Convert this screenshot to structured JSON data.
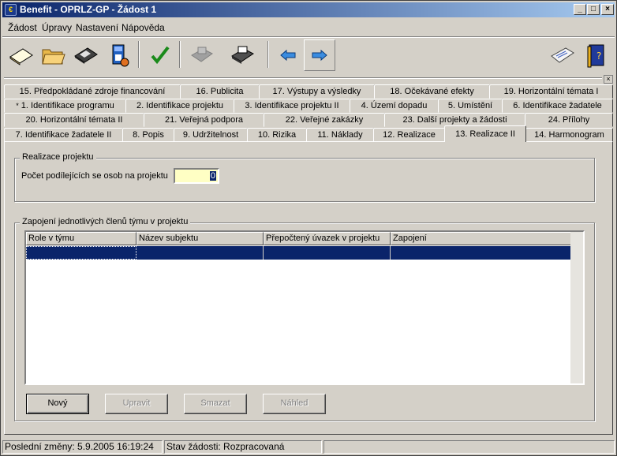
{
  "window": {
    "title": "Benefit - OPRLZ-GP - Žádost 1",
    "buttons": {
      "minimize": "_",
      "maximize": "□",
      "close": "×"
    }
  },
  "menu": [
    {
      "name": "zadost",
      "label": "Žádost"
    },
    {
      "name": "upravy",
      "label": "Úpravy"
    },
    {
      "name": "nastaveni",
      "label": "Nastavení"
    },
    {
      "name": "napoveda",
      "label": "Nápověda"
    }
  ],
  "toolbar": {
    "icons": [
      "new-document-icon",
      "open-folder-icon",
      "save-disk-icon",
      "save-as-icon",
      "check-icon",
      "print-disabled-icon",
      "print-icon",
      "arrow-left-icon",
      "arrow-right-icon",
      "send-icon",
      "help-book-icon"
    ],
    "pressed": "arrow-right-icon"
  },
  "panel_close": "×",
  "tabs": {
    "row1": [
      "15. Předpokládané zdroje financování",
      "16. Publicita",
      "17. Výstupy a výsledky",
      "18. Očekávané efekty",
      "19. Horizontální témata I"
    ],
    "row2": [
      "1. Identifikace programu",
      "2. Identifikace projektu",
      "3. Identifikace projektu II",
      "4. Území dopadu",
      "5. Umístění",
      "6. Identifikace žadatele"
    ],
    "row2_marker": "*",
    "row3": [
      "20. Horizontální témata II",
      "21. Veřejná podpora",
      "22. Veřejné zakázky",
      "23. Další projekty a žádosti",
      "24. Přílohy"
    ],
    "row4": [
      "7. Identifikace žadatele II",
      "8. Popis",
      "9. Udržitelnost",
      "10. Rizika",
      "11. Náklady",
      "12. Realizace",
      "13. Realizace II",
      "14. Harmonogram"
    ],
    "active": "13. Realizace II"
  },
  "realizace": {
    "group_title": "Realizace projektu",
    "count_label": "Počet podílejících se osob na projektu",
    "count_value": "0"
  },
  "team": {
    "group_title": "Zapojení jednotlivých členů týmu v projektu",
    "columns": [
      "Role v týmu",
      "Název subjektu",
      "Přepočtený úvazek v projektu",
      "Zapojení"
    ],
    "rows": [
      [
        "",
        "",
        "",
        ""
      ]
    ]
  },
  "buttons": {
    "new": "Nový",
    "edit": "Upravit",
    "delete": "Smazat",
    "preview": "Náhled"
  },
  "status": {
    "last_change": "Poslední změny: 5.9.2005 16:19:24",
    "state": "Stav žádosti: Rozpracovaná",
    "extra": ""
  },
  "colors": {
    "title_start": "#0a246a",
    "title_end": "#a6caf0",
    "face": "#d4d0c8",
    "selection": "#0a246a",
    "input_highlight": "#ffffc4"
  }
}
